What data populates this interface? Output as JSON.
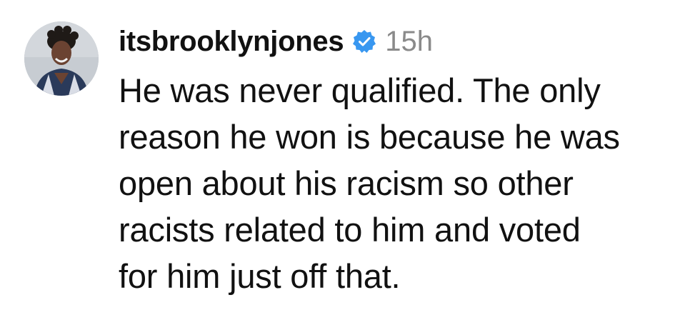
{
  "comment": {
    "avatar_icon": "user-avatar-photo",
    "username": "itsbrooklynjones",
    "verified_icon": "verified-badge-icon",
    "verified_color": "#3897f0",
    "timestamp": "15h",
    "text": "He was never qualified. The only\nreason he won is because he was\nopen about his racism so other\nracists related to him and voted\nfor him just off that."
  }
}
